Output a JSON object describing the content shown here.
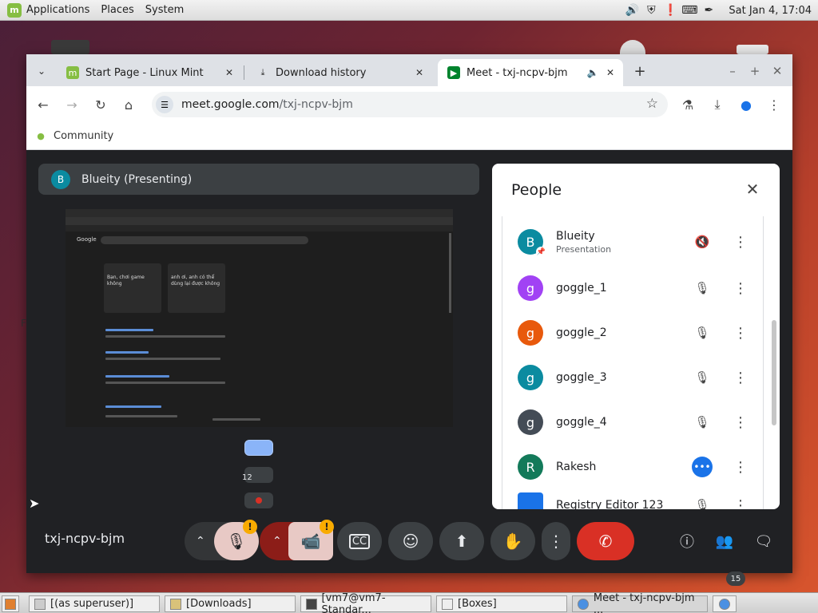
{
  "top_panel": {
    "menus": [
      "Applications",
      "Places",
      "System"
    ],
    "clock": "Sat Jan  4, 17:04"
  },
  "browser": {
    "tabs": [
      {
        "title": "Start Page - Linux Mint",
        "favicon": "linux-mint-icon"
      },
      {
        "title": "Download history",
        "favicon": "download-icon"
      },
      {
        "title": "Meet - txj-ncpv-bjm",
        "favicon": "google-meet-icon",
        "active": true,
        "audio": true
      }
    ],
    "url_host": "meet.google.com",
    "url_path": "/txj-ncpv-bjm",
    "bookmarks": [
      "Community"
    ]
  },
  "meet": {
    "presenter_initial": "B",
    "presenter_label": "Blueity (Presenting)",
    "filmstrip_count": "12",
    "meeting_code": "txj-ncpv-bjm",
    "people_count": "15",
    "people_panel": {
      "title": "People",
      "participants": [
        {
          "initial": "B",
          "name": "Blueity",
          "sub": "Presentation",
          "color": "#0b8ba0",
          "mic": "muted-presentation",
          "pinned": true
        },
        {
          "initial": "g",
          "name": "goggle_1",
          "color": "#a142f4",
          "mic": "muted"
        },
        {
          "initial": "g",
          "name": "goggle_2",
          "color": "#e8590c",
          "mic": "muted"
        },
        {
          "initial": "g",
          "name": "goggle_3",
          "color": "#0b8ba0",
          "mic": "muted"
        },
        {
          "initial": "g",
          "name": "goggle_4",
          "color": "#444c56",
          "mic": "muted"
        },
        {
          "initial": "R",
          "name": "Rakesh",
          "color": "#137a5a",
          "mic": "speaking"
        },
        {
          "initial": "",
          "name": "Registry Editor 123",
          "color": "#1a73e8",
          "mic": "muted"
        }
      ]
    },
    "screen_share": {
      "logo": "Google",
      "card_left": "Bạn, chơi game không",
      "card_right": "anh ơi, anh có thể dùng lại được không"
    }
  },
  "taskbar": {
    "items": [
      "[(as superuser)]",
      "[Downloads]",
      "[vm7@vm7-Standar...",
      "[Boxes]",
      "Meet - txj-ncpv-bjm ..."
    ]
  }
}
